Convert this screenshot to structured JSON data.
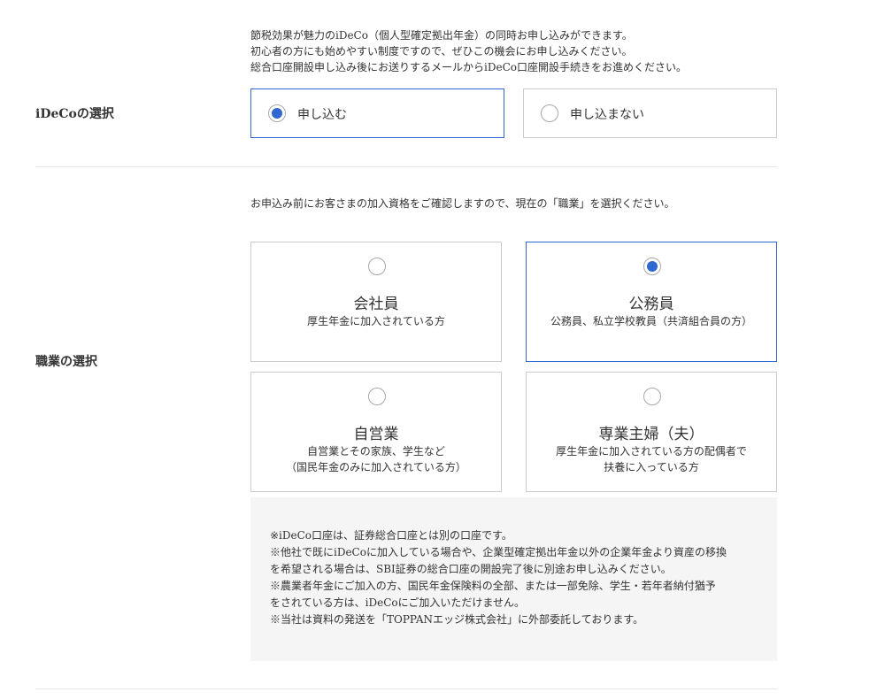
{
  "ideco": {
    "description": [
      "節税効果が魅力のiDeCo（個人型確定拠出年金）の同時お申し込みができます。",
      "初心者の方にも始めやすい制度ですので、ぜひこの機会にお申し込みください。",
      "総合口座開設申し込み後にお送りするメールからiDeCo口座開設手続きをお進めください。"
    ],
    "label": "iDeCoの選択",
    "options": [
      {
        "label": "申し込む",
        "selected": true
      },
      {
        "label": "申し込まない",
        "selected": false
      }
    ]
  },
  "occupation": {
    "description": "お申込み前にお客さまの加入資格をご確認しますので、現在の「職業」を選択ください。",
    "label": "職業の選択",
    "options": [
      {
        "title": "会社員",
        "sub": [
          "厚生年金に加入されている方"
        ],
        "selected": false
      },
      {
        "title": "公務員",
        "sub": [
          "公務員、私立学校教員（共済組合員の方）"
        ],
        "selected": true
      },
      {
        "title": "自営業",
        "sub": [
          "自営業とその家族、学生など",
          "（国民年金のみに加入されている方）"
        ],
        "selected": false
      },
      {
        "title": "専業主婦（夫）",
        "sub": [
          "厚生年金に加入されている方の配偶者で",
          "扶養に入っている方"
        ],
        "selected": false
      }
    ],
    "notes": [
      "※iDeCo口座は、証券総合口座とは別の口座です。",
      "※他社で既にiDeCoに加入している場合や、企業型確定拠出年金以外の企業年金より資産の移換",
      "を希望される場合は、SBI証券の総合口座の開設完了後に別途お申し込みください。",
      "※農業者年金にご加入の方、国民年金保険料の全部、または一部免除、学生・若年者納付猶予",
      "をされている方は、iDeCoにご加入いただけません。",
      "※当社は資料の発送を「TOPPANエッジ株式会社」に外部委託しております。"
    ]
  },
  "colors": {
    "accent": "#2f68cf",
    "border": "#cccccc",
    "divider": "#e5e5e5",
    "notes_bg": "#f5f5f5",
    "text": "#333333"
  }
}
